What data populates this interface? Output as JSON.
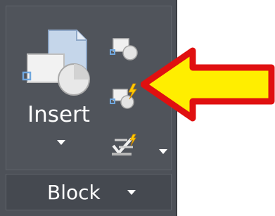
{
  "panel": {
    "insert_label": "Insert",
    "footer_label": "Block",
    "buttons": [
      {
        "name": "create-block",
        "icon": "create-block-icon"
      },
      {
        "name": "edit-block",
        "icon": "edit-block-lightning-icon"
      },
      {
        "name": "edit-attributes",
        "icon": "edit-attributes-icon"
      }
    ]
  },
  "colors": {
    "panel_bg": "#4d5158",
    "arrow_fill": "#ffee00",
    "arrow_stroke": "#e01010",
    "accent_blue": "#6fa6dd"
  }
}
